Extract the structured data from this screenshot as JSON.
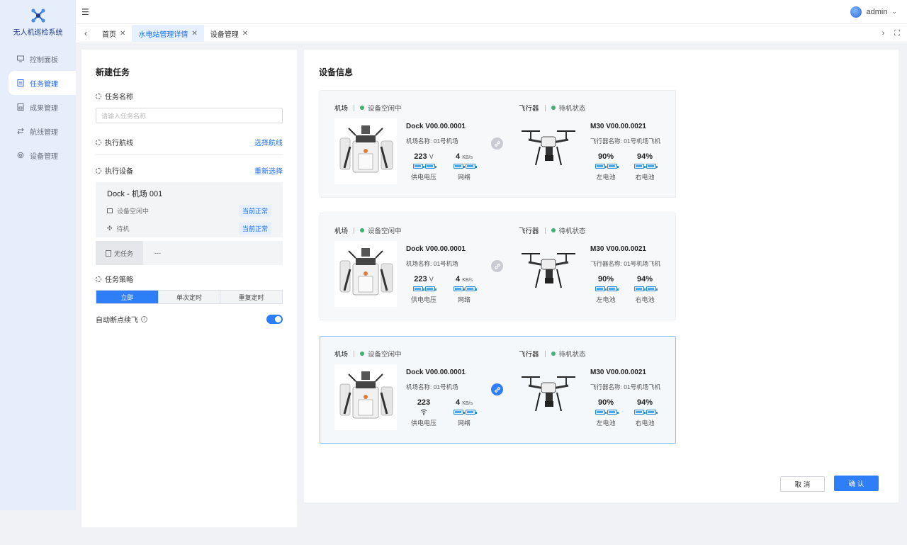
{
  "app": {
    "name": "无人机巡检系统"
  },
  "sidebar": {
    "items": [
      {
        "label": "控制面板",
        "icon": "monitor-icon",
        "active": false
      },
      {
        "label": "任务管理",
        "icon": "task-icon",
        "active": true
      },
      {
        "label": "成果管理",
        "icon": "results-icon",
        "active": false
      },
      {
        "label": "航线管理",
        "icon": "route-icon",
        "active": false
      },
      {
        "label": "设备管理",
        "icon": "gear-icon",
        "active": false
      }
    ]
  },
  "header": {
    "user": "admin"
  },
  "tabs": [
    {
      "label": "首页",
      "active": false
    },
    {
      "label": "水电站管理详情",
      "active": true
    },
    {
      "label": "设备管理",
      "active": false
    }
  ],
  "form": {
    "title": "新建任务",
    "task_name_label": "任务名称",
    "task_name_placeholder": "请输入任务名称",
    "route_label": "执行航线",
    "route_action": "选择航线",
    "device_label": "执行设备",
    "device_action": "重新选择",
    "dock": {
      "name": "Dock - 机场 001",
      "rows": [
        {
          "label": "设备空闲中",
          "status": "当前正常"
        },
        {
          "label": "待机",
          "status": "当前正常"
        }
      ]
    },
    "no_task": {
      "label": "无任务",
      "value": "---"
    },
    "strategy_label": "任务策略",
    "strategy_options": [
      "立即",
      "单次定时",
      "重复定时"
    ],
    "strategy_selected": "立即",
    "auto_resume_label": "自动断点续飞",
    "auto_resume_enabled": true
  },
  "devices": {
    "title": "设备信息",
    "cards": [
      {
        "selected": false,
        "dock_label": "机场",
        "dock_status": "设备空闲中",
        "dock_model": "Dock V00.00.0001",
        "dock_name": "机场名称: 01号机场",
        "voltage": "223",
        "voltage_unit": "V",
        "voltage_label": "供电电压",
        "network": "4",
        "network_unit": "KB/s",
        "network_label": "网络",
        "drone_label": "飞行器",
        "drone_status": "待机状态",
        "drone_model": "M30 V00.00.0021",
        "drone_name": "飞行器名称: 01号机场飞机",
        "left_battery": "90%",
        "left_label": "左电池",
        "right_battery": "94%",
        "right_label": "右电池"
      },
      {
        "selected": false,
        "dock_label": "机场",
        "dock_status": "设备空闲中",
        "dock_model": "Dock V00.00.0001",
        "dock_name": "机场名称: 01号机场",
        "voltage": "223",
        "voltage_unit": "V",
        "voltage_label": "供电电压",
        "network": "4",
        "network_unit": "KB/s",
        "network_label": "网络",
        "drone_label": "飞行器",
        "drone_status": "待机状态",
        "drone_model": "M30 V00.00.0021",
        "drone_name": "飞行器名称: 01号机场飞机",
        "left_battery": "90%",
        "left_label": "左电池",
        "right_battery": "94%",
        "right_label": "右电池"
      },
      {
        "selected": true,
        "dock_label": "机场",
        "dock_status": "设备空闲中",
        "dock_model": "Dock V00.00.0001",
        "dock_name": "机场名称: 01号机场",
        "voltage": "223",
        "voltage_unit": "",
        "voltage_label": "供电电压",
        "network": "4",
        "network_unit": "KB/s",
        "network_label": "网络",
        "drone_label": "飞行器",
        "drone_status": "待机状态",
        "drone_model": "M30 V00.00.0021",
        "drone_name": "飞行器名称: 01号机场飞机",
        "left_battery": "90%",
        "left_label": "左电池",
        "right_battery": "94%",
        "right_label": "右电池"
      }
    ]
  },
  "actions": {
    "cancel": "取 消",
    "confirm": "确 认"
  },
  "colors": {
    "primary": "#2d7ef7",
    "status_ok": "#3cb371",
    "sidebar_bg": "#e6eefb"
  }
}
